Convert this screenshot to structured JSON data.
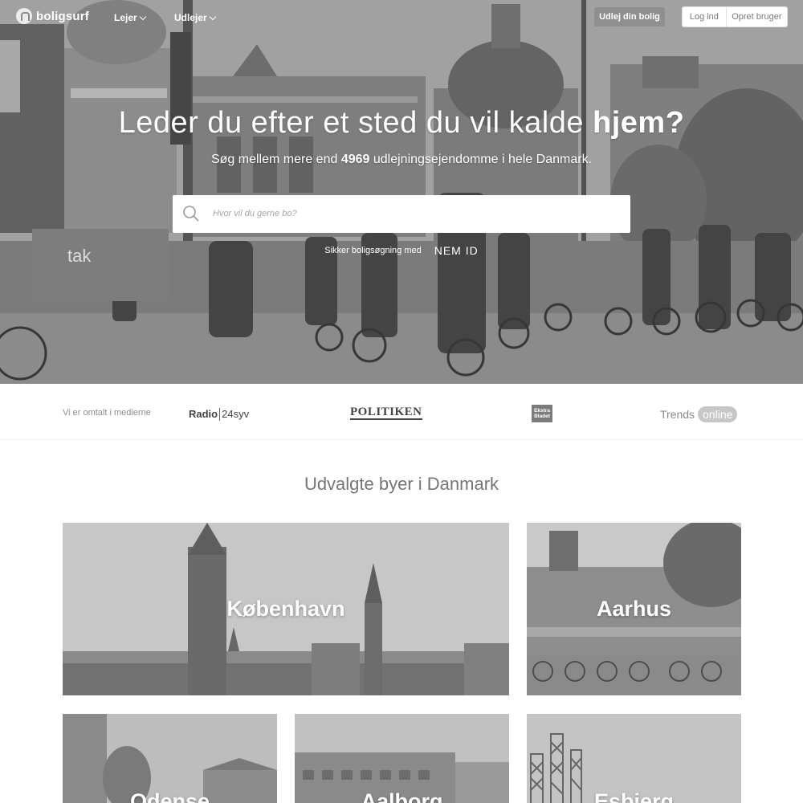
{
  "header": {
    "logo_text": "boligsurf",
    "nav": [
      {
        "label": "Lejer"
      },
      {
        "label": "Udlejer"
      }
    ],
    "cta_label": "Udlej din bolig",
    "login_label": "Log ind",
    "signup_label": "Opret bruger"
  },
  "hero": {
    "headline_prefix": "Leder du efter et sted du vil kalde ",
    "headline_bold": "hjem?",
    "sub_prefix": "Søg mellem mere end ",
    "sub_count": "4969",
    "sub_suffix": " udlejningsejendomme i hele Danmark.",
    "search_placeholder": "Hvor vil du gerne bo?",
    "secure_text": "Sikker boligsøgning med",
    "nemid_logo": "NEM ID",
    "storefront_text": "tak"
  },
  "press": {
    "label": "Vi er omtalt i medierne",
    "radio_left": "Radio",
    "radio_right": "24syv",
    "politiken": "POLITIKEN",
    "ekstra_line1": "Ekstra",
    "ekstra_line2": "Bladet",
    "trends": "Trends",
    "trends_pill": "online"
  },
  "cities": {
    "title": "Udvalgte byer i Danmark",
    "items": [
      {
        "name": "København"
      },
      {
        "name": "Aarhus"
      },
      {
        "name": "Odense"
      },
      {
        "name": "Aalborg"
      },
      {
        "name": "Esbjerg"
      }
    ]
  }
}
